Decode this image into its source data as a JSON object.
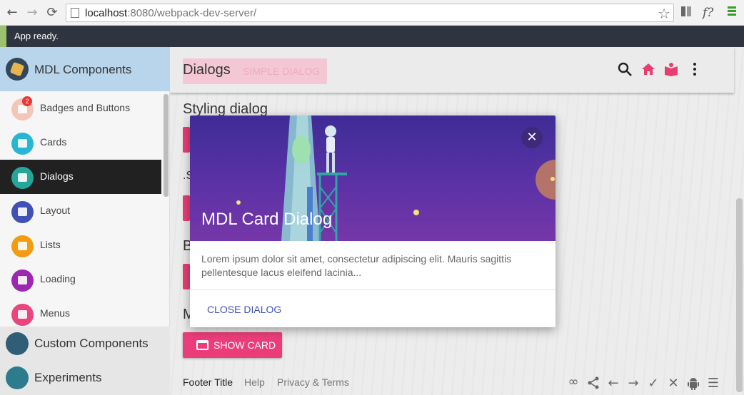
{
  "browser": {
    "url_host": "localhost",
    "url_rest": ":8080/webpack-dev-server/",
    "ext_label": "f?"
  },
  "notification": {
    "text": "App ready."
  },
  "drawer": {
    "title": "MDL Components",
    "subitems": [
      {
        "label": "Badges and Buttons",
        "icon": "chat-bubble-icon",
        "color": "#f4c6b8",
        "badge": "2"
      },
      {
        "label": "Cards",
        "icon": "card-icon",
        "color": "#29b6d5"
      },
      {
        "label": "Dialogs",
        "icon": "dialog-icon",
        "color": "#26a69a",
        "active": true
      },
      {
        "label": "Layout",
        "icon": "layout-icon",
        "color": "#3f51b5"
      },
      {
        "label": "Lists",
        "icon": "list-icon",
        "color": "#f39c12"
      },
      {
        "label": "Loading",
        "icon": "spinner-icon",
        "color": "#9c27b0"
      },
      {
        "label": "Menus",
        "icon": "menu-icon",
        "color": "#e8467c"
      }
    ],
    "main_items": [
      {
        "label": "Custom Components",
        "icon": "puzzle-icon"
      },
      {
        "label": "Experiments",
        "icon": "flask-icon"
      }
    ]
  },
  "header": {
    "title": "Dialogs",
    "ghost_button": "SIMPLE DIALOG"
  },
  "sections": {
    "styling_title": "Styling dialog",
    "partial_s": ".S",
    "partial_b": "B",
    "partial_m": "M"
  },
  "show_card": {
    "label": "SHOW CARD"
  },
  "footer": {
    "title": "Footer Title",
    "help": "Help",
    "privacy": "Privacy & Terms"
  },
  "dialog": {
    "title": "MDL Card Dialog",
    "body": "Lorem ipsum dolor sit amet, consectetur adipiscing elit. Mauris sagittis pellentesque lacus eleifend lacinia...",
    "action": "CLOSE DIALOG"
  },
  "colors": {
    "accent": "#e93d72",
    "primary_text": "#3f51b5",
    "dialog_media": "#5b32a6"
  }
}
